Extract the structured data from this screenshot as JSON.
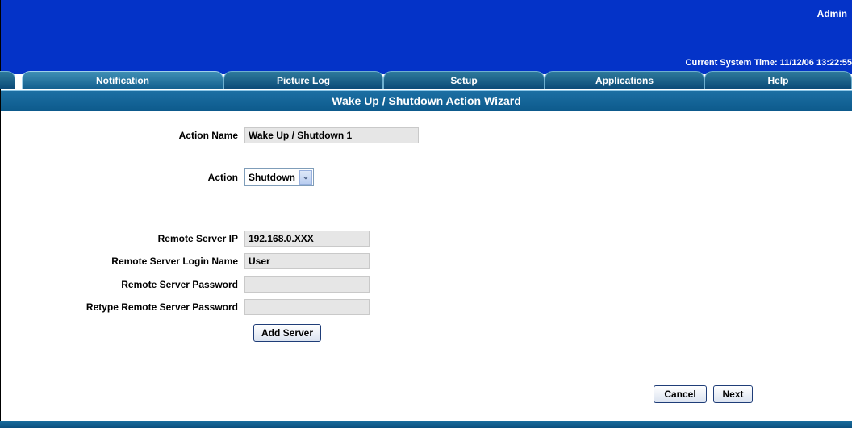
{
  "header": {
    "user": "Admin",
    "system_time": "Current System Time: 11/12/06 13:22:55"
  },
  "tabs": [
    {
      "label": "Notification",
      "active": true
    },
    {
      "label": "Picture Log",
      "active": false
    },
    {
      "label": "Setup",
      "active": false
    },
    {
      "label": "Applications",
      "active": false
    },
    {
      "label": "Help",
      "active": false
    }
  ],
  "page_title": "Wake Up / Shutdown Action Wizard",
  "form": {
    "action_name": {
      "label": "Action Name",
      "value": "Wake Up / Shutdown 1"
    },
    "action": {
      "label": "Action",
      "selected": "Shutdown"
    },
    "remote_ip": {
      "label": "Remote Server IP",
      "value": "192.168.0.XXX"
    },
    "login_name": {
      "label": "Remote Server Login Name",
      "value": "User"
    },
    "password": {
      "label": "Remote Server Password",
      "value": ""
    },
    "retype_password": {
      "label": "Retype Remote Server Password",
      "value": ""
    },
    "add_server_label": "Add Server"
  },
  "buttons": {
    "cancel": "Cancel",
    "next": "Next"
  },
  "colors": {
    "header_bg": "#0433c8",
    "tab_bg": "#0c4b78",
    "title_bar_bg": "#0d5a8c"
  }
}
